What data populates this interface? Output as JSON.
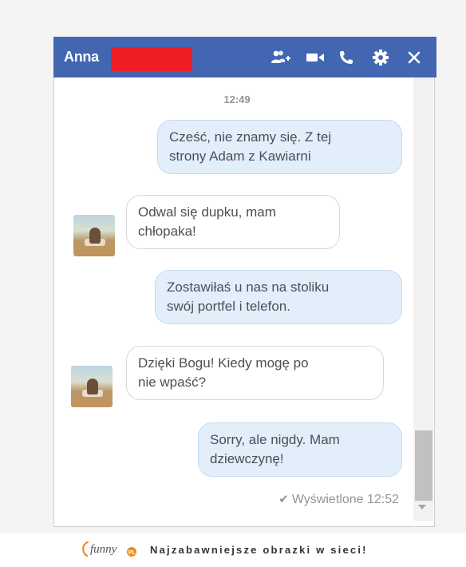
{
  "header": {
    "name": "Anna",
    "icons": [
      "add-people-icon",
      "video-call-icon",
      "phone-icon",
      "gear-icon",
      "close-icon"
    ]
  },
  "conversation": {
    "timestamp": "12:49",
    "messages": [
      {
        "direction": "outgoing",
        "lines": [
          "Cześć, nie znamy się. Z tej",
          "strony Adam z Kawiarni"
        ]
      },
      {
        "direction": "incoming",
        "lines": [
          "Odwal się dupku, mam",
          "chłopaka!"
        ]
      },
      {
        "direction": "outgoing",
        "lines": [
          "Zostawiłaś u nas na stoliku",
          "swój portfel i telefon."
        ]
      },
      {
        "direction": "incoming",
        "lines": [
          "Dzięki Bogu! Kiedy mogę po",
          "nie wpaść?"
        ]
      },
      {
        "direction": "outgoing",
        "lines": [
          "Sorry, ale nigdy. Mam",
          "dziewczynę!"
        ]
      }
    ],
    "seen": "Wyświetlone 12:52"
  },
  "footer": {
    "logo_text": "funny",
    "logo_suffix": "PL",
    "tagline": "Najzabawniejsze obrazki w sieci!"
  },
  "colors": {
    "header": "#4266b2",
    "redaction": "#ee1e24",
    "outgoing_bubble": "#e3eefb",
    "incoming_bubble": "#ffffff",
    "logo_orange": "#f08a1d"
  }
}
